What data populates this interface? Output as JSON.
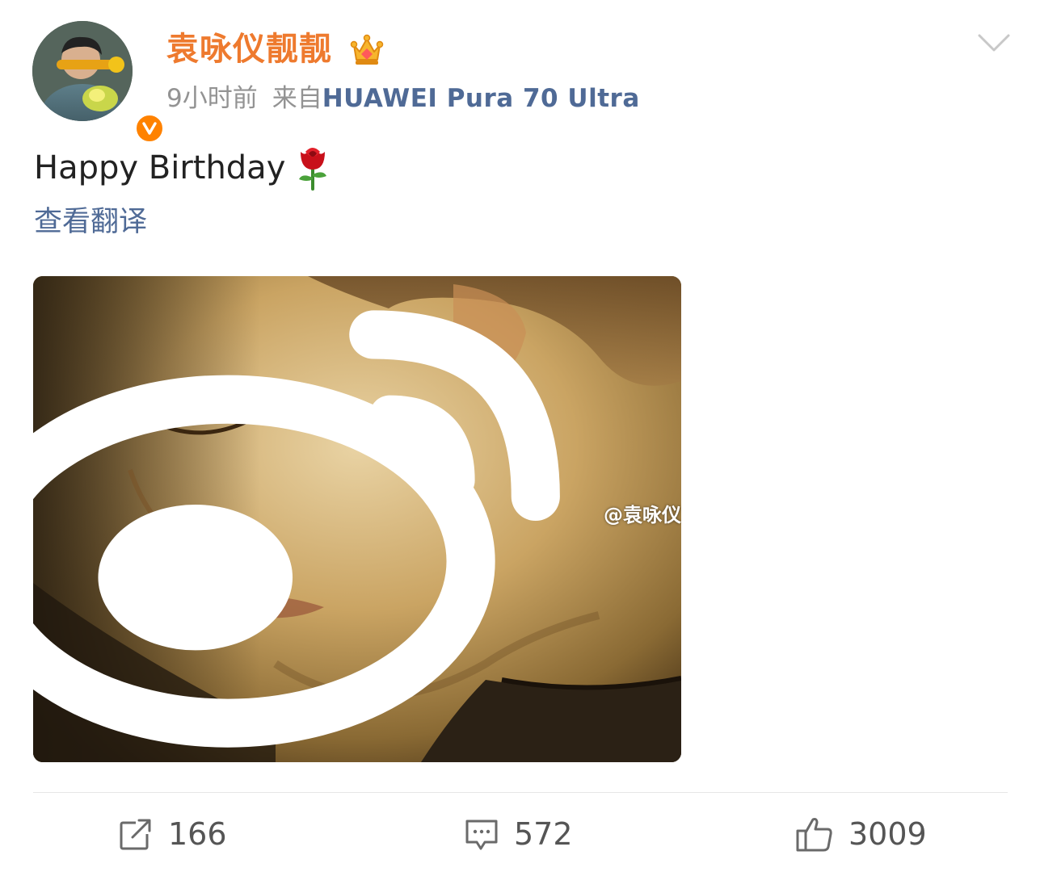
{
  "colors": {
    "username": "#ee7a2e",
    "link": "#4f6a96",
    "meta_gray": "#939393",
    "verified_badge": "#ff8200",
    "divider": "#e6e6e6",
    "action_gray": "#555555"
  },
  "header": {
    "avatar_icon": "avatar-image",
    "verified_icon": "verified-v-badge-icon",
    "username": "袁咏仪靓靓",
    "vip_icon": "vip-crown-icon",
    "time": "9小时前",
    "from_label": "来自",
    "device": "HUAWEI Pura 70 Ultra",
    "menu_icon": "chevron-down-icon"
  },
  "post": {
    "text": "Happy Birthday",
    "emoji": "rose-emoji",
    "translate_label": "查看翻译",
    "image_watermark": "@袁咏仪"
  },
  "actions": {
    "repost": {
      "icon": "repost-icon",
      "count": "166"
    },
    "comment": {
      "icon": "comment-icon",
      "count": "572"
    },
    "like": {
      "icon": "thumbs-up-icon",
      "count": "3009"
    }
  }
}
